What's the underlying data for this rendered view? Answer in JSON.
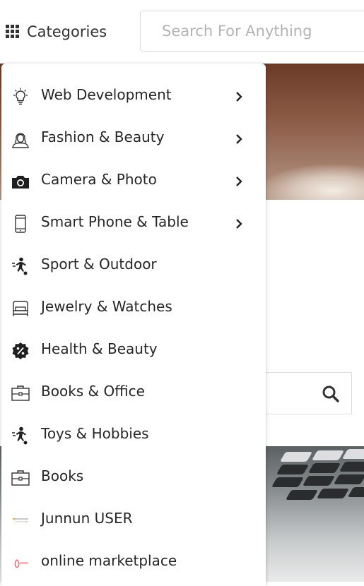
{
  "header": {
    "categories_label": "Categories",
    "search_placeholder": "Search For Anything"
  },
  "menu": {
    "items": [
      {
        "label": "Web Development",
        "icon": "lightbulb-icon",
        "has_submenu": true
      },
      {
        "label": "Fashion & Beauty",
        "icon": "woman-avatar-icon",
        "has_submenu": true
      },
      {
        "label": "Camera & Photo",
        "icon": "camera-icon",
        "has_submenu": true
      },
      {
        "label": "Smart Phone & Table",
        "icon": "smartphone-icon",
        "has_submenu": true
      },
      {
        "label": "Sport & Outdoor",
        "icon": "soccer-player-icon",
        "has_submenu": false
      },
      {
        "label": "Jewelry & Watches",
        "icon": "bed-icon",
        "has_submenu": false
      },
      {
        "label": "Health & Beauty",
        "icon": "percent-badge-icon",
        "has_submenu": false
      },
      {
        "label": "Books & Office",
        "icon": "briefcase-icon",
        "has_submenu": false
      },
      {
        "label": "Toys & Hobbies",
        "icon": "soccer-player-icon",
        "has_submenu": false
      },
      {
        "label": "Books",
        "icon": "briefcase-icon",
        "has_submenu": false
      },
      {
        "label": "Junnun USER",
        "icon": "brand-logo-icon",
        "has_submenu": false
      },
      {
        "label": "online marketplace",
        "icon": "airbnb-logo-icon",
        "has_submenu": false
      }
    ]
  },
  "colors": {
    "text": "#262626",
    "border": "#dcdcdc",
    "placeholder": "#b3b3b3",
    "airbnb_accent": "#ff5a5f"
  }
}
